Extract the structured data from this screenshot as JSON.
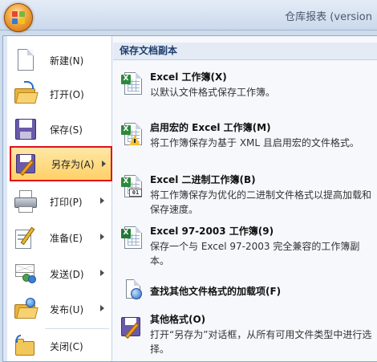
{
  "window": {
    "title": "仓库报表 (version"
  },
  "office_button": {
    "label": ""
  },
  "left_menu": {
    "items": [
      {
        "label": "新建(N)",
        "arrow": false,
        "icon": "new-document-icon"
      },
      {
        "label": "打开(O)",
        "arrow": false,
        "icon": "open-folder-icon"
      },
      {
        "label": "保存(S)",
        "arrow": false,
        "icon": "save-disk-icon"
      },
      {
        "label": "另存为(A)",
        "arrow": true,
        "selected": true,
        "icon": "save-as-icon"
      },
      {
        "label": "打印(P)",
        "arrow": true,
        "icon": "printer-icon"
      },
      {
        "label": "准备(E)",
        "arrow": true,
        "icon": "prepare-icon"
      },
      {
        "label": "发送(D)",
        "arrow": true,
        "icon": "send-icon"
      },
      {
        "label": "发布(U)",
        "arrow": true,
        "icon": "publish-icon"
      },
      {
        "label": "关闭(C)",
        "arrow": false,
        "icon": "close-folder-icon"
      }
    ]
  },
  "save_copy": {
    "header": "保存文档副本",
    "options": [
      {
        "title": "Excel 工作簿(X)",
        "desc": "以默认文件格式保存工作簿。",
        "icon": "excel-workbook-icon"
      },
      {
        "title": "启用宏的 Excel 工作簿(M)",
        "desc": "将工作簿保存为基于 XML 且启用宏的文件格式。",
        "icon": "excel-macro-workbook-icon"
      },
      {
        "title": "Excel 二进制工作簿(B)",
        "desc": "将工作簿保存为优化的二进制文件格式以提高加载和保存速度。",
        "icon": "excel-binary-workbook-icon"
      },
      {
        "title": "Excel 97-2003 工作簿(9)",
        "desc": "保存一个与 Excel 97-2003 完全兼容的工作簿副本。",
        "icon": "excel-97-2003-icon"
      },
      {
        "title": "查找其他文件格式的加载项(F)",
        "desc": "",
        "icon": "find-addins-icon"
      },
      {
        "title": "其他格式(O)",
        "desc": "打开“另存为”对话框，从所有可用文件类型中进行选择。",
        "icon": "other-formats-icon"
      }
    ]
  },
  "colors": {
    "selection_border": "#e0101a",
    "selection_fill": "#ffd167",
    "header_text": "#1e3e6e"
  }
}
